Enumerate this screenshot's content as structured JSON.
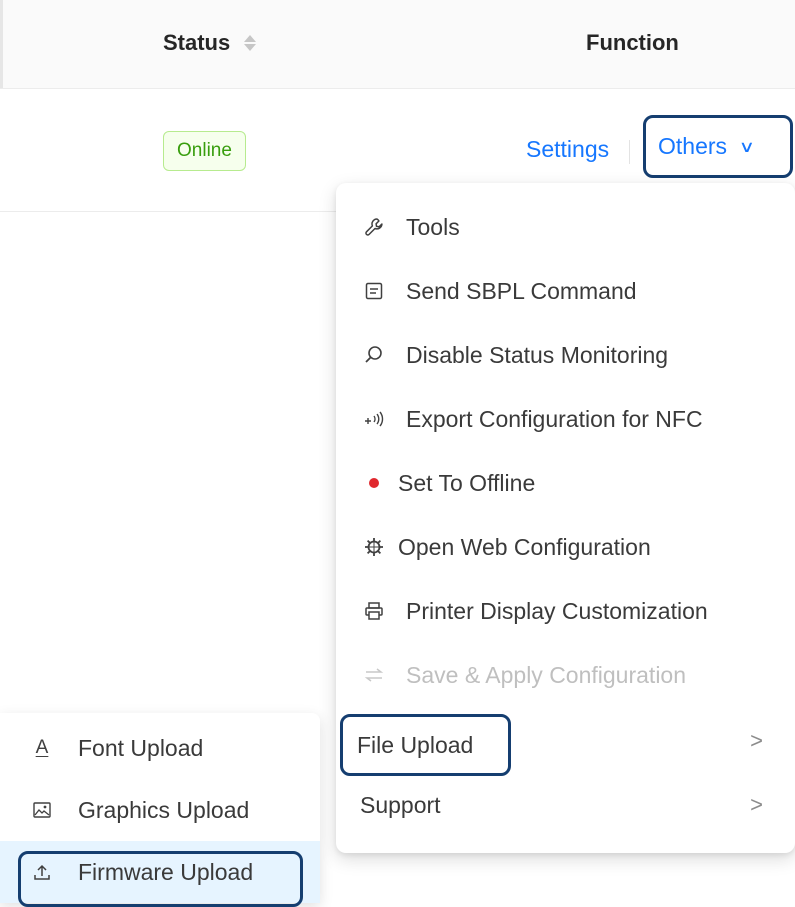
{
  "table": {
    "headers": {
      "status": "Status",
      "function": "Function"
    },
    "row": {
      "status_tag": "Online",
      "settings_link": "Settings",
      "others_button": "Others"
    }
  },
  "dropdown": {
    "items": [
      {
        "label": "Tools",
        "icon": "wrench-icon"
      },
      {
        "label": "Send SBPL Command",
        "icon": "command-box-icon"
      },
      {
        "label": "Disable Status Monitoring",
        "icon": "search-monitor-icon"
      },
      {
        "label": "Export Configuration for NFC",
        "icon": "nfc-icon"
      },
      {
        "label": "Set To Offline",
        "icon": "red-dot-icon"
      },
      {
        "label": "Open Web Configuration",
        "icon": "web-gear-icon"
      },
      {
        "label": "Printer Display Customization",
        "icon": "printer-icon"
      },
      {
        "label": "Save & Apply Configuration",
        "icon": "swap-arrows-icon",
        "disabled": true
      },
      {
        "label": "File Upload",
        "icon": "",
        "submenu": true
      },
      {
        "label": "Support",
        "icon": "",
        "submenu": true
      }
    ]
  },
  "submenu": {
    "items": [
      {
        "label": "Font Upload",
        "icon": "font-icon"
      },
      {
        "label": "Graphics Upload",
        "icon": "image-icon"
      },
      {
        "label": "Firmware Upload",
        "icon": "upload-icon",
        "active": true
      }
    ]
  },
  "colors": {
    "link": "#1677ff",
    "highlight_border": "#153e70",
    "online_green": "#389e0d",
    "active_bg": "#e6f4ff"
  }
}
